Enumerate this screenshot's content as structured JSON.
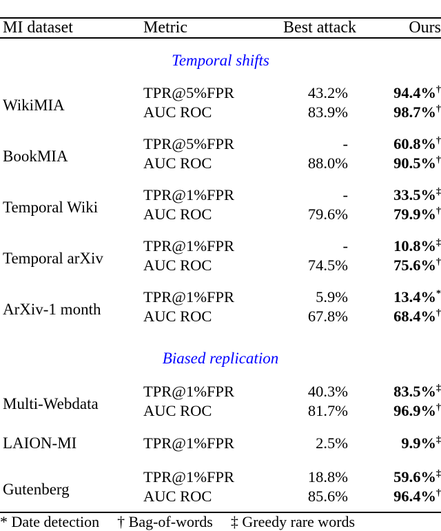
{
  "table": {
    "columns": [
      {
        "key": "dataset",
        "label": "MI dataset",
        "align": "left"
      },
      {
        "key": "metric",
        "label": "Metric",
        "align": "left"
      },
      {
        "key": "best_attack",
        "label": "Best attack",
        "align": "right"
      },
      {
        "key": "ours",
        "label": "Ours",
        "align": "right"
      }
    ],
    "sections": [
      {
        "title": "Temporal shifts",
        "color": "#0000ff",
        "rows": [
          {
            "dataset": "WikiMIA",
            "metrics": [
              {
                "metric": "TPR@5%FPR",
                "best_attack": "43.2%",
                "ours": "94.4%",
                "ours_mark": "†"
              },
              {
                "metric": "AUC ROC",
                "best_attack": "83.9%",
                "ours": "98.7%",
                "ours_mark": "†"
              }
            ]
          },
          {
            "dataset": "BookMIA",
            "metrics": [
              {
                "metric": "TPR@5%FPR",
                "best_attack": "-",
                "ours": "60.8%",
                "ours_mark": "†"
              },
              {
                "metric": "AUC ROC",
                "best_attack": "88.0%",
                "ours": "90.5%",
                "ours_mark": "†"
              }
            ]
          },
          {
            "dataset": "Temporal Wiki",
            "metrics": [
              {
                "metric": "TPR@1%FPR",
                "best_attack": "-",
                "ours": "33.5%",
                "ours_mark": "‡"
              },
              {
                "metric": "AUC ROC",
                "best_attack": "79.6%",
                "ours": "79.9%",
                "ours_mark": "†"
              }
            ]
          },
          {
            "dataset": "Temporal arXiv",
            "metrics": [
              {
                "metric": "TPR@1%FPR",
                "best_attack": "-",
                "ours": "10.8%",
                "ours_mark": "‡"
              },
              {
                "metric": "AUC ROC",
                "best_attack": "74.5%",
                "ours": "75.6%",
                "ours_mark": "†"
              }
            ]
          },
          {
            "dataset": "ArXiv-1 month",
            "metrics": [
              {
                "metric": "TPR@1%FPR",
                "best_attack": "5.9%",
                "ours": "13.4%",
                "ours_mark": "*"
              },
              {
                "metric": "AUC ROC",
                "best_attack": "67.8%",
                "ours": "68.4%",
                "ours_mark": "†"
              }
            ]
          }
        ]
      },
      {
        "title": "Biased replication",
        "color": "#0000ff",
        "rows": [
          {
            "dataset": "Multi-Webdata",
            "metrics": [
              {
                "metric": "TPR@1%FPR",
                "best_attack": "40.3%",
                "ours": "83.5%",
                "ours_mark": "‡"
              },
              {
                "metric": "AUC ROC",
                "best_attack": "81.7%",
                "ours": "96.9%",
                "ours_mark": "†"
              }
            ]
          },
          {
            "dataset": "LAION-MI",
            "metrics": [
              {
                "metric": "TPR@1%FPR",
                "best_attack": "2.5%",
                "ours": "9.9%",
                "ours_mark": "‡"
              }
            ]
          },
          {
            "dataset": "Gutenberg",
            "metrics": [
              {
                "metric": "TPR@1%FPR",
                "best_attack": "18.8%",
                "ours": "59.6%",
                "ours_mark": "‡"
              },
              {
                "metric": "AUC ROC",
                "best_attack": "85.6%",
                "ours": "96.4%",
                "ours_mark": "†"
              }
            ]
          }
        ]
      }
    ],
    "footnotes": [
      {
        "mark": "*",
        "text": "Date detection"
      },
      {
        "mark": "†",
        "text": "Bag-of-words"
      },
      {
        "mark": "‡",
        "text": "Greedy rare words"
      }
    ]
  }
}
